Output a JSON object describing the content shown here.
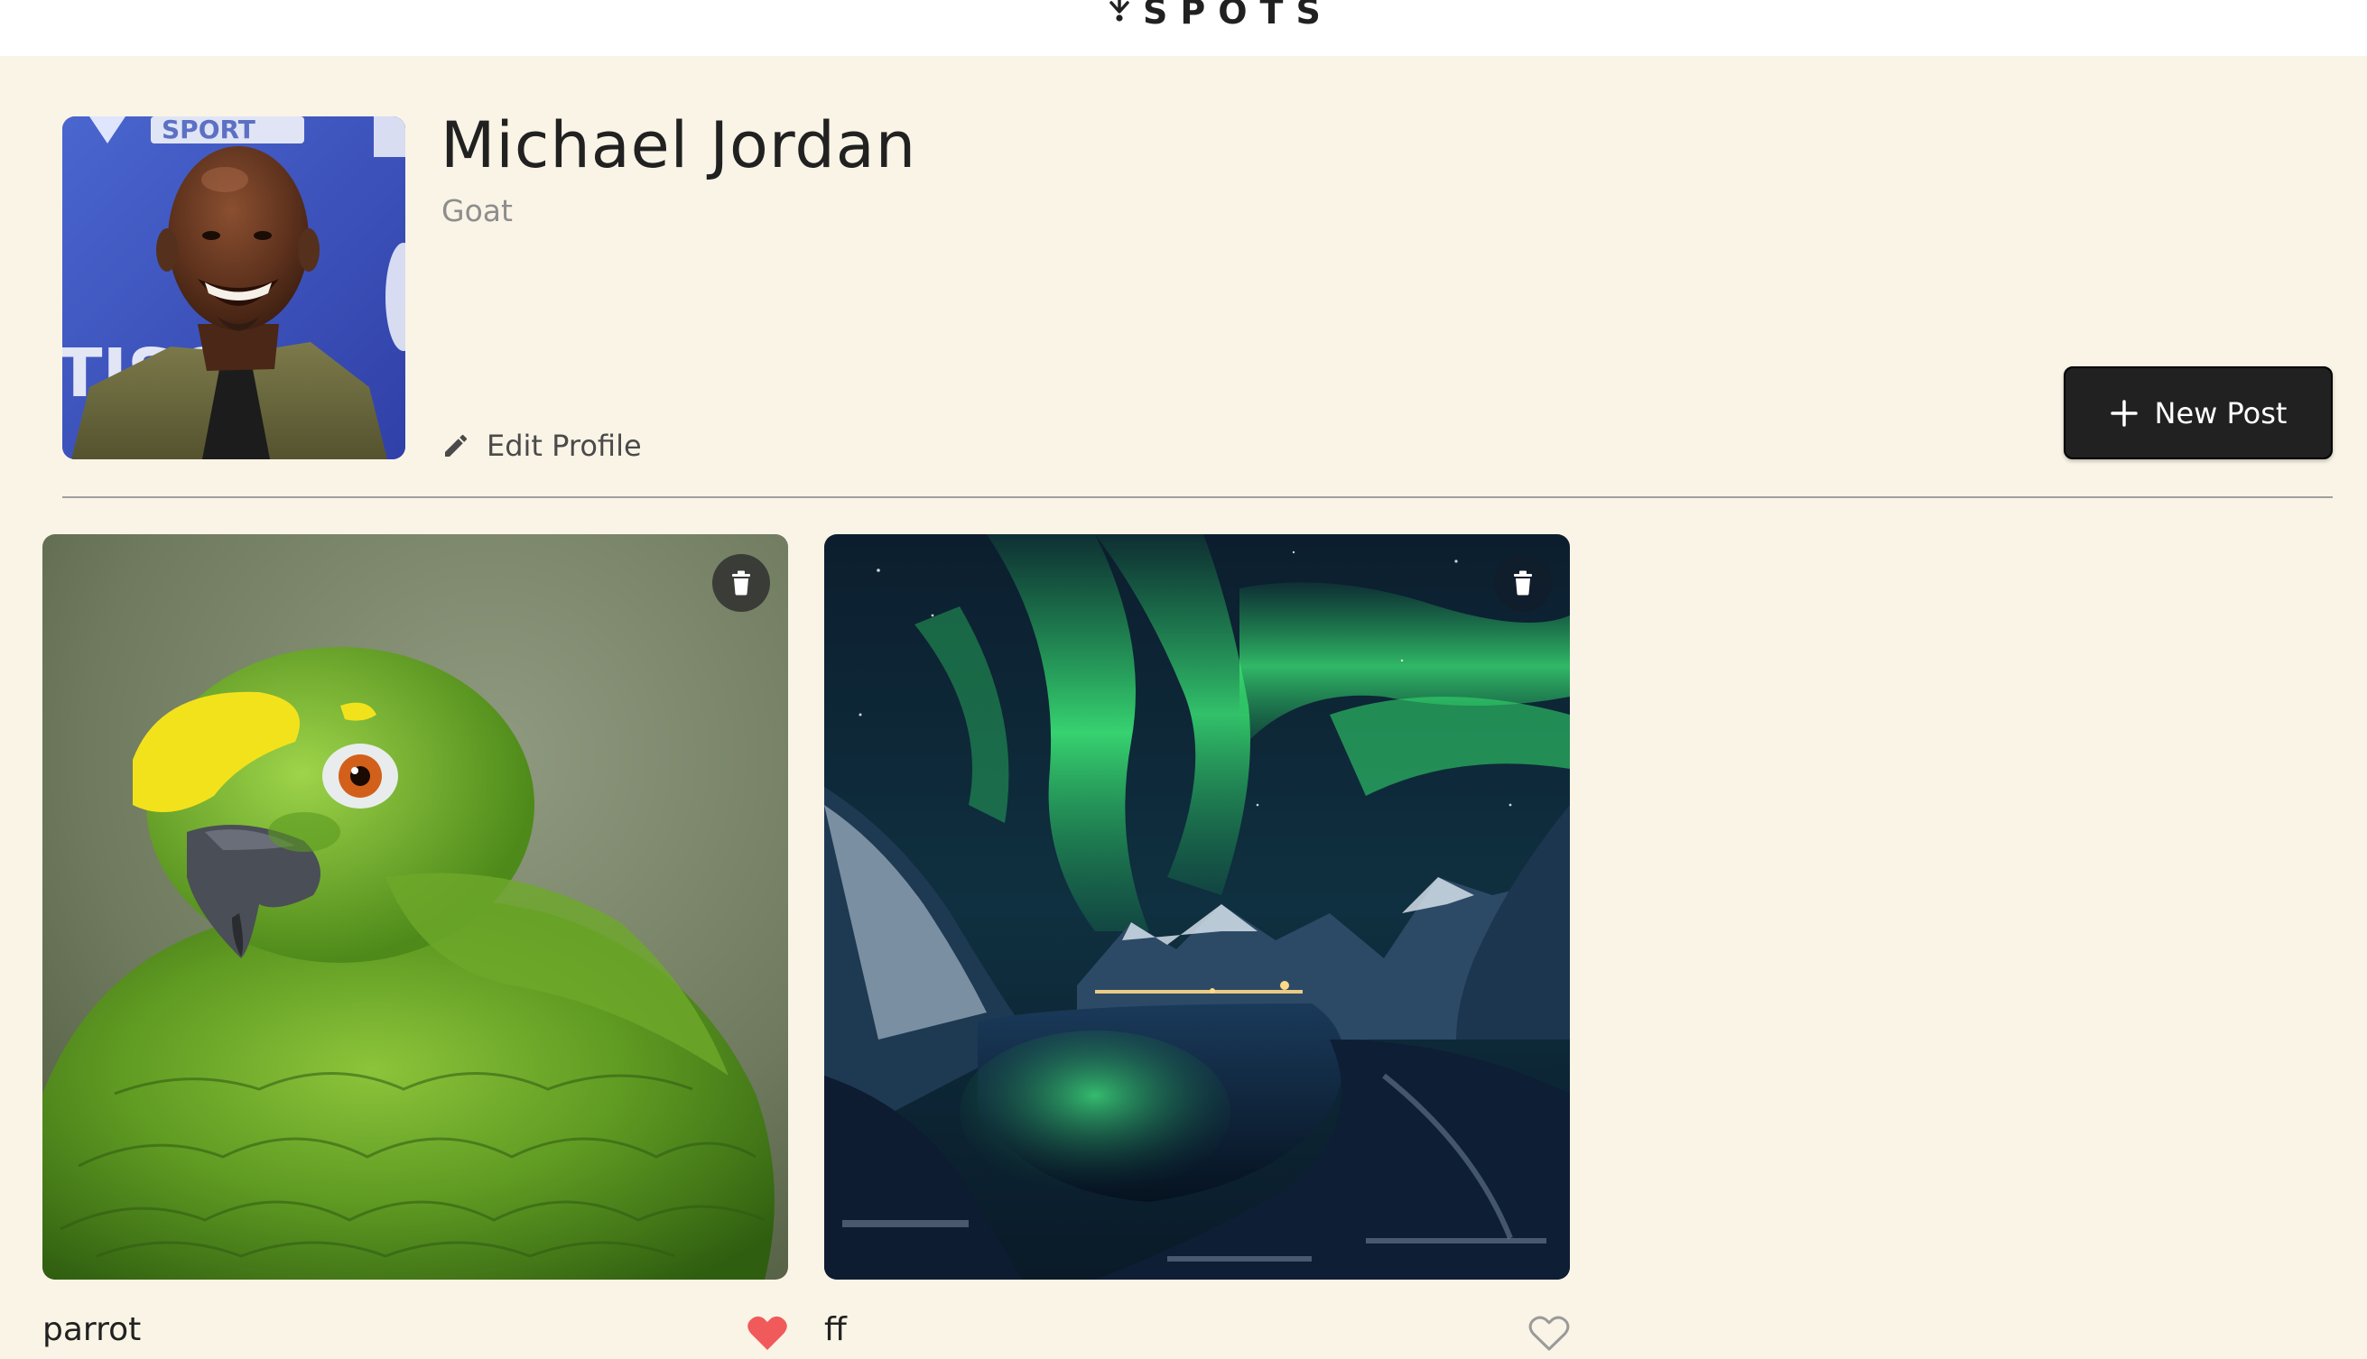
{
  "header": {
    "logo_text": "SPOTS",
    "logo_icon": "spots-pin-logo-icon"
  },
  "profile": {
    "name": "Michael Jordan",
    "description": "Goat",
    "edit_label": "Edit Profile",
    "edit_icon": "pencil-icon",
    "avatar_alt": "Michael Jordan avatar"
  },
  "actions": {
    "new_post_label": "New Post",
    "new_post_icon": "plus-icon"
  },
  "cards": [
    {
      "title": "parrot",
      "image_alt": "parrot",
      "liked": true,
      "like_icon": "heart-filled-icon",
      "delete_icon": "trash-icon"
    },
    {
      "title": "ff",
      "image_alt": "ff",
      "liked": false,
      "like_icon": "heart-outline-icon",
      "delete_icon": "trash-icon"
    }
  ],
  "colors": {
    "background": "#faf4e6",
    "header": "#ffffff",
    "text": "#212121",
    "muted": "#8d8d8d",
    "button": "#212121",
    "like_active": "#f15a5a"
  }
}
